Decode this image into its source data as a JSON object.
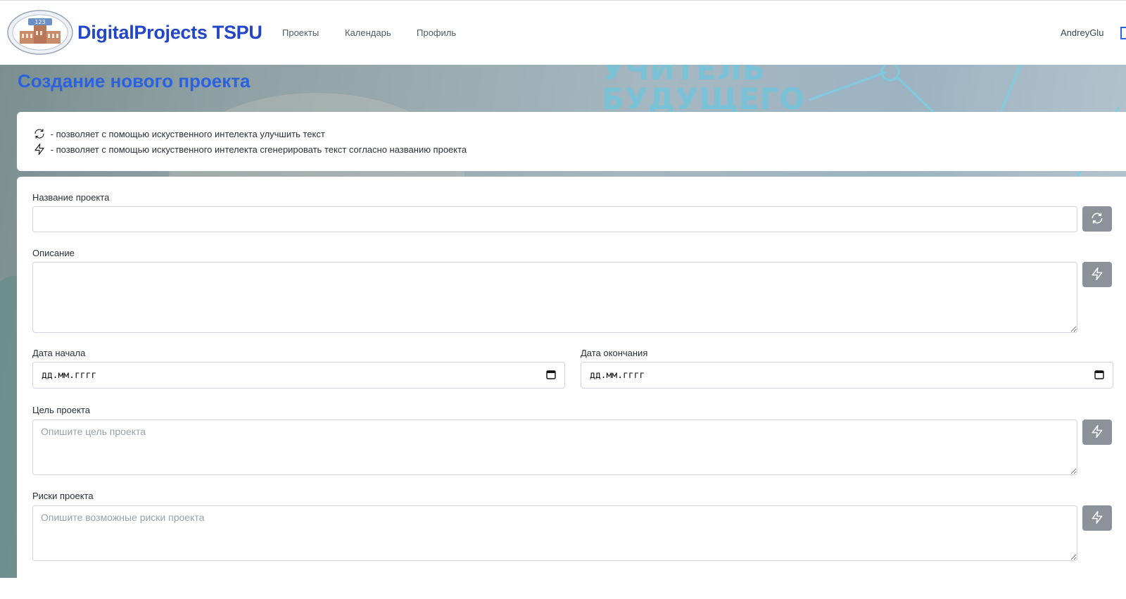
{
  "header": {
    "brand": "DigitalProjects TSPU",
    "logo_number": "123",
    "nav": [
      {
        "label": "Проекты"
      },
      {
        "label": "Календарь"
      },
      {
        "label": "Профиль"
      }
    ],
    "username": "AndreyGlu",
    "icons": {
      "logout": "logout-icon"
    }
  },
  "background": {
    "banner_line1": "УЧИТЕЛЬ",
    "banner_line2": "БУДУЩЕГО"
  },
  "page": {
    "title": "Создание нового проекта"
  },
  "hints": [
    {
      "icon": "refresh-icon",
      "text": "- позволяет с помощью искуственного интелекта улучшить текст"
    },
    {
      "icon": "lightning-icon",
      "text": "- позволяет с помощью искуственного интелекта сгенерировать текст согласно названию проекта"
    }
  ],
  "form": {
    "name": {
      "label": "Название проекта",
      "value": "",
      "placeholder": "",
      "button_icon": "refresh-icon"
    },
    "description": {
      "label": "Описание",
      "value": "",
      "placeholder": "",
      "button_icon": "lightning-icon"
    },
    "start_date": {
      "label": "Дата начала",
      "value": "дд.мм.гггг",
      "icon": "calendar-icon"
    },
    "end_date": {
      "label": "Дата окончания",
      "value": "дд.мм.гггг",
      "icon": "calendar-icon"
    },
    "goal": {
      "label": "Цель проекта",
      "value": "",
      "placeholder": "Опишите цель проекта",
      "button_icon": "lightning-icon"
    },
    "risks": {
      "label": "Риски проекта",
      "value": "",
      "placeholder": "Опишите возможные риски проекта",
      "button_icon": "lightning-icon"
    }
  },
  "colors": {
    "brand": "#2246c8",
    "title": "#2a62e0",
    "ai_button": "#8d9199"
  }
}
